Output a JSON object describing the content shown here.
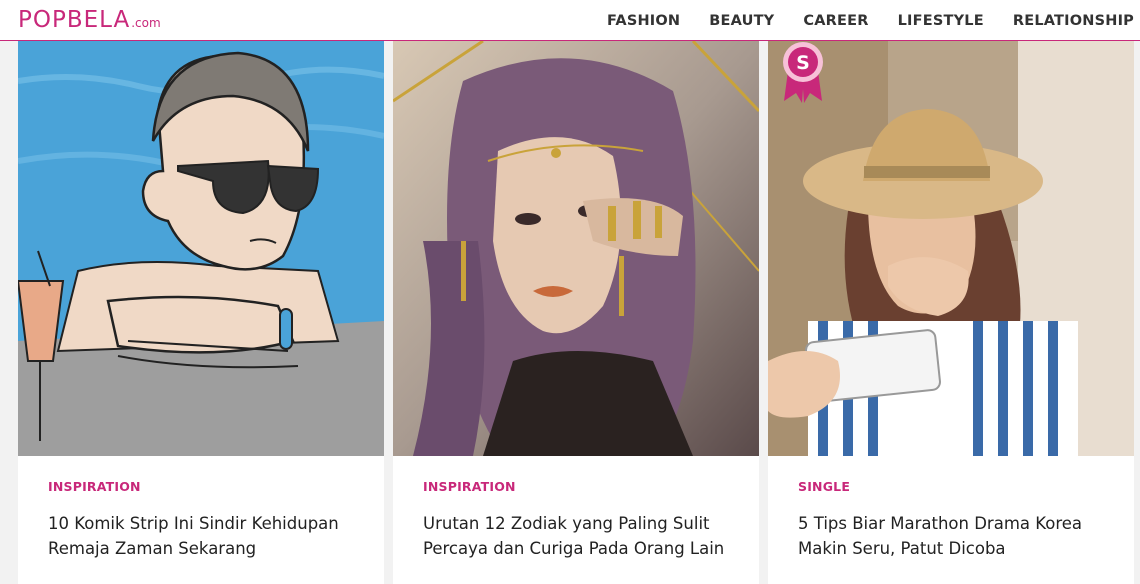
{
  "header": {
    "logo_main": "POPBELA",
    "logo_suffix": ".com",
    "nav": [
      "FASHION",
      "BEAUTY",
      "CAREER",
      "LIFESTYLE",
      "RELATIONSHIP"
    ]
  },
  "colors": {
    "brand": "#c8287a",
    "title_text": "#222222"
  },
  "cards": [
    {
      "category": "INSPIRATION",
      "title": "10 Komik Strip Ini Sindir Kehidupan Remaja Zaman Sekarang",
      "image": "illustration-woman-sunglasses-pool"
    },
    {
      "category": "INSPIRATION",
      "title": "Urutan 12 Zodiak yang Paling Sulit Percaya dan Curiga Pada Orang Lain",
      "image": "watercolor-woman-portrait"
    },
    {
      "category": "SINGLE",
      "title": "5 Tips Biar Marathon Drama Korea Makin Seru, Patut Dicoba",
      "image": "woman-straw-hat-laughing-phone",
      "badge": "S"
    }
  ]
}
